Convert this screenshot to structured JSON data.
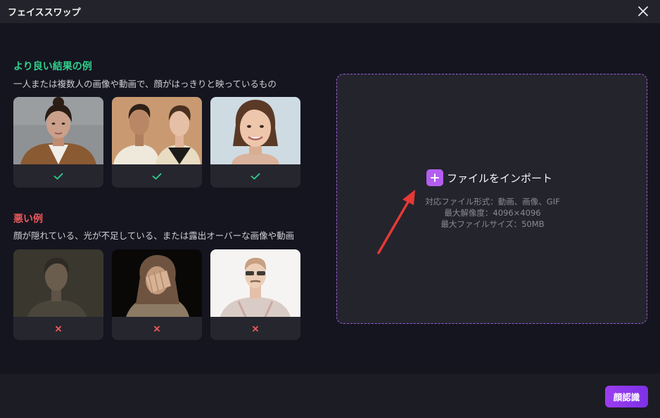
{
  "window": {
    "title": "フェイススワップ"
  },
  "good_examples": {
    "title": "より良い結果の例",
    "description": "一人または複数人の画像や動画で、顔がはっきりと映っているもの",
    "images": [
      {
        "subject": "woman-brown-coat",
        "verdict": "check-icon"
      },
      {
        "subject": "two-young-men",
        "verdict": "check-icon"
      },
      {
        "subject": "smiling-woman",
        "verdict": "check-icon"
      }
    ]
  },
  "bad_examples": {
    "title": "悪い例",
    "description": "顔が隠れている、光が不足している、または露出オーバーな画像や動画",
    "images": [
      {
        "subject": "dark-blurry-woman",
        "verdict": "cross-icon"
      },
      {
        "subject": "hand-covering-face",
        "verdict": "cross-icon"
      },
      {
        "subject": "overexposed-man",
        "verdict": "cross-icon"
      }
    ]
  },
  "import": {
    "label": "ファイルをインポート",
    "formats": "対応ファイル形式：動画、画像、GIF",
    "max_resolution": "最大解像度：4096×4096",
    "max_size": "最大ファイルサイズ：50MB"
  },
  "footer": {
    "detect_label": "顔認識"
  },
  "colors": {
    "accent": "#9c3df0",
    "good": "#2fd08b",
    "bad": "#f05a5a",
    "arrow": "#e53935"
  }
}
